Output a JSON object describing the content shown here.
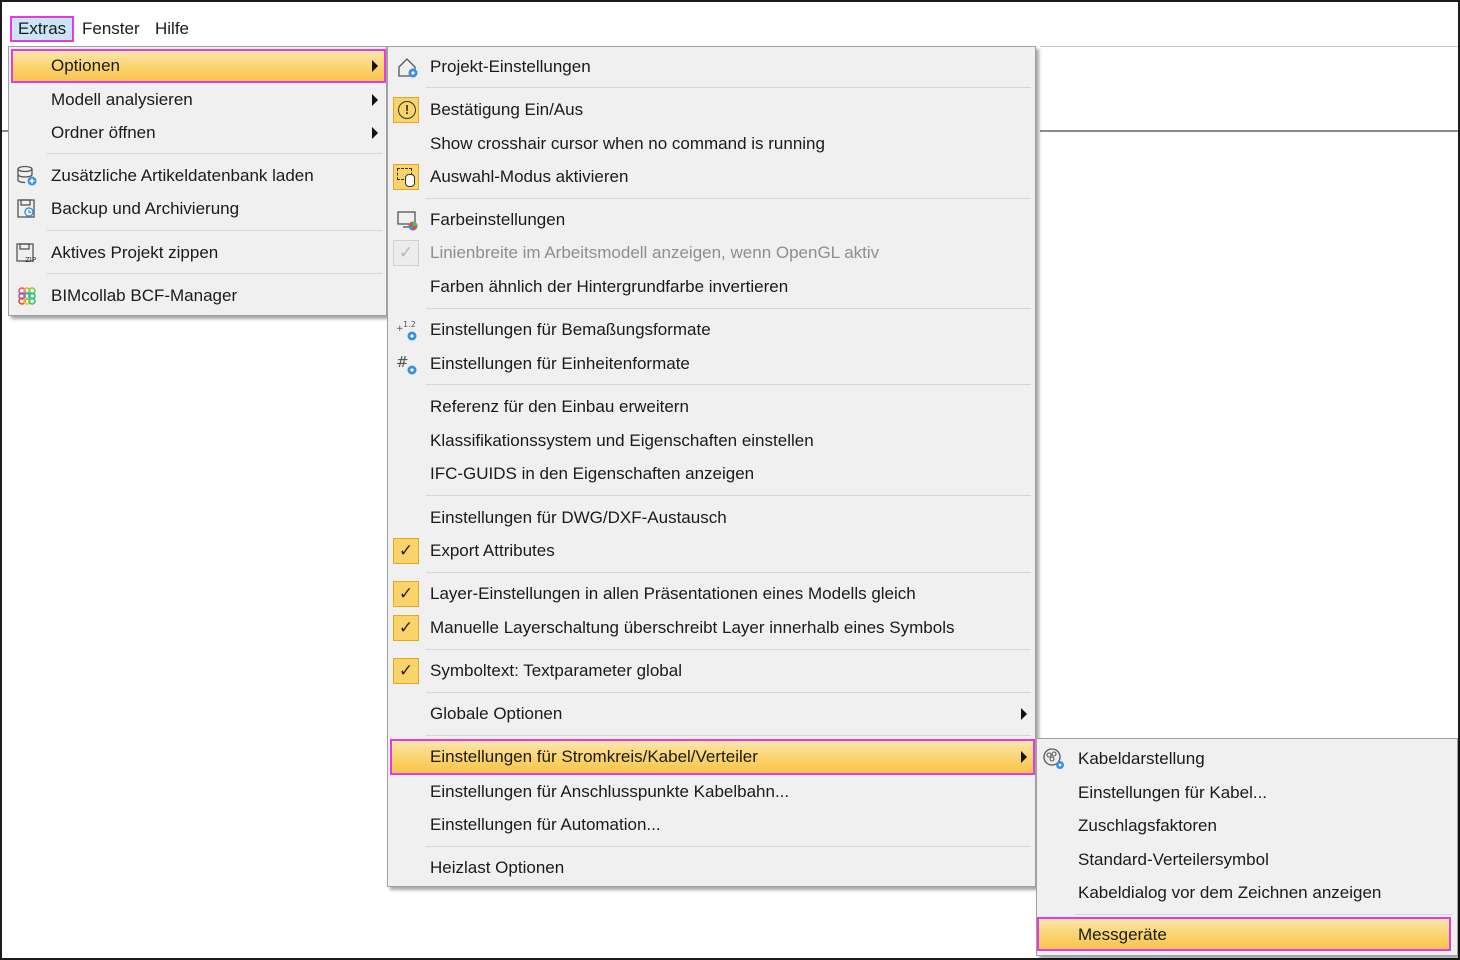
{
  "menubar": {
    "items": [
      "Extras",
      "Fenster",
      "Hilfe"
    ]
  },
  "menu1": {
    "optionen": "Optionen",
    "modell_analysieren": "Modell analysieren",
    "ordner_oeffnen": "Ordner öffnen",
    "zusatz_db": "Zusätzliche Artikeldatenbank laden",
    "backup": "Backup und Archivierung",
    "zippen": "Aktives Projekt zippen",
    "bcf": "BIMcollab BCF-Manager"
  },
  "menu2": {
    "projekt_einstellungen": "Projekt-Einstellungen",
    "bestaetigung": "Bestätigung Ein/Aus",
    "crosshair": "Show crosshair cursor when no command is running",
    "auswahl_modus": "Auswahl-Modus aktivieren",
    "farbeinstellungen": "Farbeinstellungen",
    "linienbreite": "Linienbreite im Arbeitsmodell anzeigen, wenn OpenGL aktiv",
    "farben_invertieren": "Farben ähnlich der Hintergrundfarbe invertieren",
    "bemassungsformate": "Einstellungen für Bemaßungsformate",
    "einheitenformate": "Einstellungen für Einheitenformate",
    "referenz": "Referenz für den Einbau erweitern",
    "klassifikation": "Klassifikationssystem und Eigenschaften einstellen",
    "ifc_guids": "IFC-GUIDS in den Eigenschaften anzeigen",
    "dwg": "Einstellungen für DWG/DXF-Austausch",
    "export_attributes": "Export Attributes",
    "layer_gleich": "Layer-Einstellungen in allen Präsentationen eines Modells gleich",
    "layerschaltung": "Manuelle Layerschaltung überschreibt Layer innerhalb eines Symbols",
    "symboltext": "Symboltext: Textparameter global",
    "globale_optionen": "Globale Optionen",
    "stromkreis": "Einstellungen für Stromkreis/Kabel/Verteiler",
    "anschlusspunkte": "Einstellungen für Anschlusspunkte Kabelbahn...",
    "automation": "Einstellungen für Automation...",
    "heizlast": "Heizlast Optionen"
  },
  "menu3": {
    "kabeldarstellung": "Kabeldarstellung",
    "einstellungen_kabel": "Einstellungen für Kabel...",
    "zuschlagsfaktoren": "Zuschlagsfaktoren",
    "verteilersymbol": "Standard-Verteilersymbol",
    "kabeldialog": "Kabeldialog vor dem Zeichnen anzeigen",
    "messgeraete": "Messgeräte"
  },
  "checked": {
    "linienbreite": true,
    "export_attributes": true,
    "layer_gleich": true,
    "layerschaltung": true,
    "symboltext": true
  },
  "colors": {
    "highlight": "#fbd36b",
    "callout": "#e23be2",
    "menu_bg": "#f0f0f0"
  }
}
